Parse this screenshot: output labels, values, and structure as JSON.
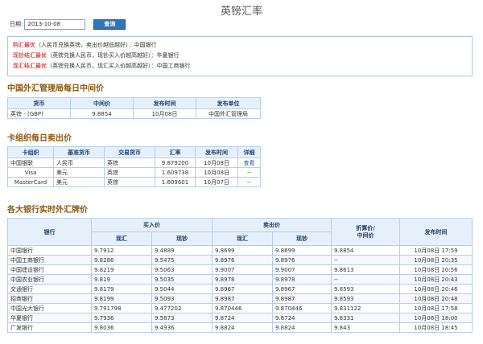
{
  "page_title": "英镑汇率",
  "query": {
    "date_label": "日期:",
    "date_value": "2013-10-08",
    "button_label": "查询"
  },
  "best_rates": [
    {
      "key": "购汇最优",
      "rest": "（人民币兑换英镑，卖出价越低越好）：中国银行"
    },
    {
      "key": "现钞结汇最优",
      "rest": "（英镑兑换人民币，现钞买入价越高越好）：华夏银行"
    },
    {
      "key": "现汇结汇最优",
      "rest": "（英镑兑换人民币，现汇买入价越高越好）：中国工商银行"
    }
  ],
  "safe": {
    "title": "中国外汇管理局每日中间价",
    "headers": [
      "货币",
      "中间价",
      "发布时间",
      "发布单位"
    ],
    "row": [
      "英镑 - (GBP)",
      "9.8854",
      "10月08日",
      "中国外汇管理局"
    ]
  },
  "cards": {
    "title": "卡组织每日卖出价",
    "headers": [
      "卡组织",
      "基准货币",
      "交易货币",
      "汇率",
      "发布时间",
      "详细"
    ],
    "rows": [
      {
        "org": "中国银联",
        "base": "人民币",
        "trade": "英镑",
        "rate": "9.879200",
        "time": "10月08日",
        "detail": "查看"
      },
      {
        "org": "Visa",
        "base": "美元",
        "trade": "英镑",
        "rate": "1.609738",
        "time": "10月08日",
        "detail": "--"
      },
      {
        "org": "MasterCard",
        "base": "美元",
        "trade": "英镑",
        "rate": "1.609601",
        "time": "10月07日",
        "detail": "--"
      }
    ]
  },
  "banks": {
    "title": "各大银行实时外汇牌价",
    "headers": {
      "bank": "银行",
      "buy": "买入价",
      "sell": "卖出价",
      "conv_line1": "折算价/",
      "conv_line2": "中间价",
      "time": "发布时间",
      "spot": "现汇",
      "cash": "现钞"
    },
    "rows": [
      {
        "bank": "中国银行",
        "buy_spot": "9.7912",
        "buy_cash": "9.4889",
        "sell_spot": "9.8699",
        "sell_cash": "9.8699",
        "mid": "9.8854",
        "time": "10月08日  17:59"
      },
      {
        "bank": "中国工商银行",
        "buy_spot": "9.8286",
        "buy_cash": "9.5475",
        "sell_spot": "9.8976",
        "sell_cash": "9.8976",
        "mid": "--",
        "time": "10月08日  20:35"
      },
      {
        "bank": "中国建设银行",
        "buy_spot": "9.8219",
        "buy_cash": "9.5063",
        "sell_spot": "9.9007",
        "sell_cash": "9.9007",
        "mid": "9.8613",
        "time": "10月08日  20:56"
      },
      {
        "bank": "中国农业银行",
        "buy_spot": "9.819",
        "buy_cash": "9.5035",
        "sell_spot": "9.8978",
        "sell_cash": "9.8978",
        "mid": "--",
        "time": "10月08日  20:43"
      },
      {
        "bank": "交通银行",
        "buy_spot": "9.8179",
        "buy_cash": "9.5044",
        "sell_spot": "9.8967",
        "sell_cash": "9.8967",
        "mid": "9.8593",
        "time": "10月08日  20:46"
      },
      {
        "bank": "招商银行",
        "buy_spot": "9.8199",
        "buy_cash": "9.5093",
        "sell_spot": "9.8987",
        "sell_cash": "9.8987",
        "mid": "9.8593",
        "time": "10月08日  20:48"
      },
      {
        "bank": "中国光大银行",
        "buy_spot": "9.791798",
        "buy_cash": "9.477202",
        "sell_spot": "9.870446",
        "sell_cash": "9.870446",
        "mid": "9.831122",
        "time": "10月08日  17:58"
      },
      {
        "bank": "华夏银行",
        "buy_spot": "9.7936",
        "buy_cash": "9.5873",
        "sell_spot": "9.8724",
        "sell_cash": "9.8724",
        "mid": "9.8331",
        "time": "10月08日  18:00"
      },
      {
        "bank": "广发银行",
        "buy_spot": "9.8036",
        "buy_cash": "9.4936",
        "sell_spot": "9.8824",
        "sell_cash": "9.8824",
        "mid": "9.843",
        "time": "10月08日  18:45"
      }
    ]
  }
}
